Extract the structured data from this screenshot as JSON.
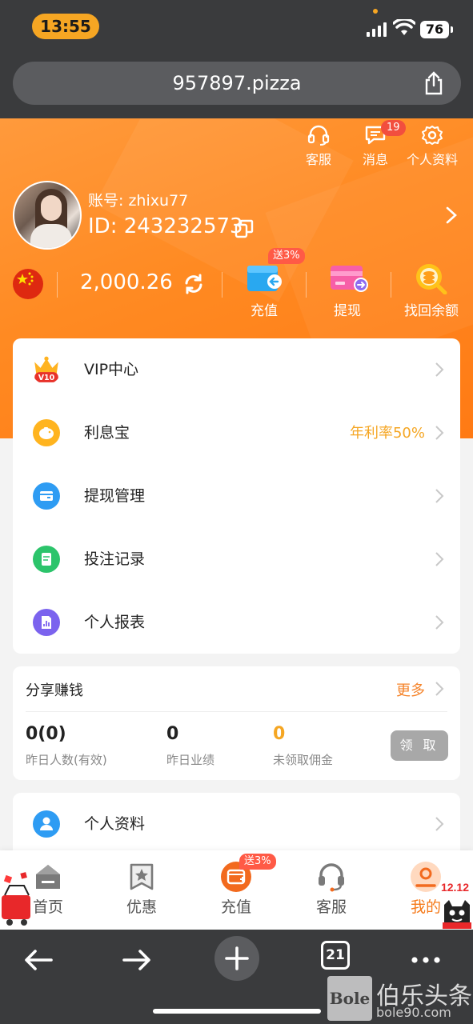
{
  "status_bar": {
    "time": "13:55",
    "battery": "76"
  },
  "browser": {
    "url": "957897.pizza",
    "tabs_count": "21"
  },
  "header": {
    "top_icons": [
      {
        "label": "客服",
        "icon": "headset-icon"
      },
      {
        "label": "消息",
        "icon": "message-icon",
        "badge": "19"
      },
      {
        "label": "个人资料",
        "icon": "gear-icon"
      }
    ],
    "account_label": "账号: zhixu77",
    "id_label": "ID: 243232573",
    "balance": "2,000.26",
    "actions": [
      {
        "label": "充值",
        "icon": "deposit-icon",
        "badge": "送3%"
      },
      {
        "label": "提现",
        "icon": "withdraw-card-icon"
      },
      {
        "label": "找回余额",
        "icon": "recover-balance-icon"
      }
    ]
  },
  "menu": [
    {
      "label": "VIP中心",
      "icon": "vip-crown-icon",
      "vip_level": "V10"
    },
    {
      "label": "利息宝",
      "icon": "piggy-bank-icon",
      "right_text": "年利率50%"
    },
    {
      "label": "提现管理",
      "icon": "wallet-icon"
    },
    {
      "label": "投注记录",
      "icon": "bet-record-icon"
    },
    {
      "label": "个人报表",
      "icon": "report-icon"
    }
  ],
  "share": {
    "title": "分享赚钱",
    "more": "更多",
    "stats": [
      {
        "value": "0(0)",
        "label": "昨日人数(有效)",
        "color": "#222222"
      },
      {
        "value": "0",
        "label": "昨日业绩",
        "color": "#222222"
      },
      {
        "value": "0",
        "label": "未领取佣金",
        "color": "#f5a623"
      }
    ],
    "claim_button": "领 取"
  },
  "profile_row": {
    "label": "个人资料",
    "icon": "profile-user-icon"
  },
  "tabbar": [
    {
      "label": "首页",
      "icon": "home-icon"
    },
    {
      "label": "优惠",
      "icon": "promo-star-icon"
    },
    {
      "label": "充值",
      "icon": "deposit-tab-icon",
      "badge": "送3%"
    },
    {
      "label": "客服",
      "icon": "support-headset-icon"
    },
    {
      "label": "我的",
      "icon": "my-profile-icon",
      "active": true
    }
  ],
  "corner_promo": "12.12",
  "watermark": {
    "box": "Bole",
    "text": "伯乐头条",
    "sub": "bole90.com"
  },
  "colors": {
    "accent": "#ff8a22",
    "highlight": "#f5a623",
    "active_tab": "#f57a1a"
  }
}
